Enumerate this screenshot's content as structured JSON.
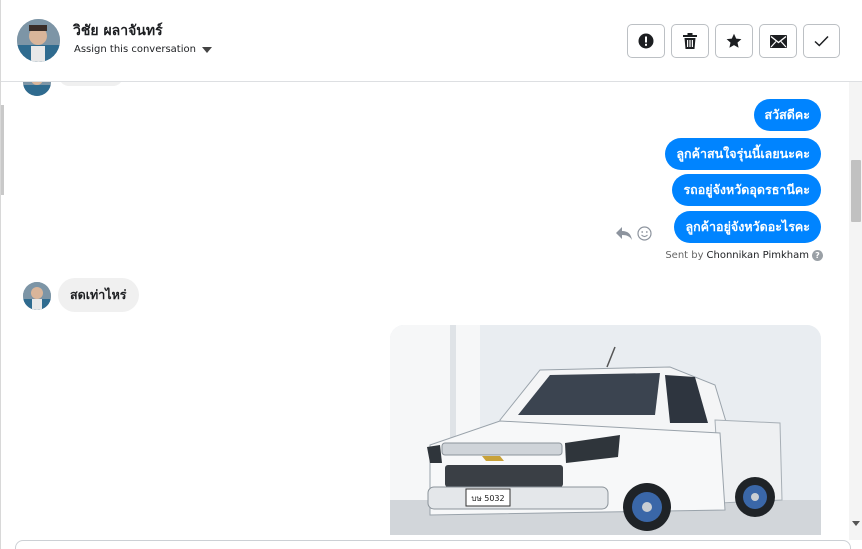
{
  "header": {
    "contact_name": "วิชัย ผลาจันทร์",
    "assign_label": "Assign this conversation",
    "actions": [
      {
        "name": "mark-spam-button",
        "icon": "alert-icon"
      },
      {
        "name": "delete-button",
        "icon": "trash-icon"
      },
      {
        "name": "star-button",
        "icon": "star-icon"
      },
      {
        "name": "mark-unread-button",
        "icon": "envelope-icon"
      },
      {
        "name": "mark-done-button",
        "icon": "check-icon"
      }
    ]
  },
  "messages": {
    "outgoing": [
      "สวัสดีคะ",
      "ลูกค้าสนใจรุ่นนี้เลยนะคะ",
      "รถอยู่จังหวัดอุดรธานีคะ",
      "ลูกค้าอยู่จังหวัดอะไรคะ"
    ],
    "sent_by_prefix": "Sent by",
    "sent_by_name": "Chonnikan Pimkham",
    "incoming": [
      "สดเท่าไหร่"
    ],
    "photo": {
      "plate": "บษ 5032",
      "description_icon": "pickup-truck-photo"
    }
  },
  "colors": {
    "brand_blue": "#0084ff",
    "incoming_bubble": "#f0f0f0"
  }
}
